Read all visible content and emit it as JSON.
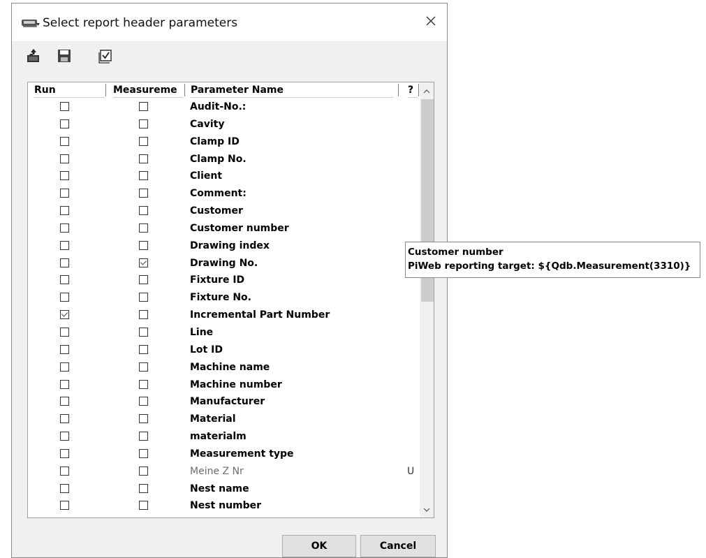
{
  "window": {
    "title": "Select report header parameters"
  },
  "icons": {
    "app": "app-logo-icon",
    "close": "close-icon",
    "open": "open-folder-icon",
    "save": "save-icon",
    "check_all": "check-all-icon"
  },
  "table": {
    "columns": {
      "run": "Run",
      "measurement": "Measureme",
      "name": "Parameter Name",
      "flag": "?"
    },
    "rows": [
      {
        "name": "Audit-No.:",
        "run": false,
        "measurement": false
      },
      {
        "name": "Cavity",
        "run": false,
        "measurement": false
      },
      {
        "name": "Clamp ID",
        "run": false,
        "measurement": false
      },
      {
        "name": "Clamp No.",
        "run": false,
        "measurement": false
      },
      {
        "name": "Client",
        "run": false,
        "measurement": false
      },
      {
        "name": "Comment:",
        "run": false,
        "measurement": false
      },
      {
        "name": "Customer",
        "run": false,
        "measurement": false
      },
      {
        "name": "Customer number",
        "run": false,
        "measurement": false
      },
      {
        "name": "Drawing index",
        "run": false,
        "measurement": false
      },
      {
        "name": "Drawing No.",
        "run": false,
        "measurement": true
      },
      {
        "name": "Fixture ID",
        "run": false,
        "measurement": false
      },
      {
        "name": "Fixture No.",
        "run": false,
        "measurement": false
      },
      {
        "name": "Incremental Part Number",
        "run": true,
        "measurement": false
      },
      {
        "name": "Line",
        "run": false,
        "measurement": false
      },
      {
        "name": "Lot ID",
        "run": false,
        "measurement": false
      },
      {
        "name": "Machine name",
        "run": false,
        "measurement": false
      },
      {
        "name": "Machine number",
        "run": false,
        "measurement": false
      },
      {
        "name": "Manufacturer",
        "run": false,
        "measurement": false
      },
      {
        "name": "Material",
        "run": false,
        "measurement": false
      },
      {
        "name": "materialm",
        "run": false,
        "measurement": false
      },
      {
        "name": "Measurement type",
        "run": false,
        "measurement": false
      },
      {
        "name": "Meine Z Nr",
        "run": false,
        "measurement": false,
        "flag": "U",
        "dimmed": true
      },
      {
        "name": "Nest name",
        "run": false,
        "measurement": false
      },
      {
        "name": "Nest number",
        "run": false,
        "measurement": false
      }
    ]
  },
  "tooltip": {
    "line1": "Customer number",
    "line2": "PiWeb reporting target: ${Qdb.Measurement(3310)}"
  },
  "buttons": {
    "ok": "OK",
    "cancel": "Cancel"
  }
}
